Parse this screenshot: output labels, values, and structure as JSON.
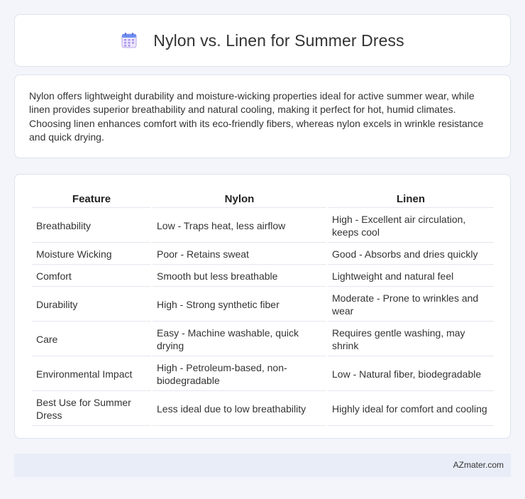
{
  "header": {
    "title": "Nylon vs. Linen for Summer Dress",
    "icon": "calendar-icon"
  },
  "summary": "Nylon offers lightweight durability and moisture-wicking properties ideal for active summer wear, while linen provides superior breathability and natural cooling, making it perfect for hot, humid climates. Choosing linen enhances comfort with its eco-friendly fibers, whereas nylon excels in wrinkle resistance and quick drying.",
  "table": {
    "headers": [
      "Feature",
      "Nylon",
      "Linen"
    ],
    "rows": [
      [
        "Breathability",
        "Low - Traps heat, less airflow",
        "High - Excellent air circulation, keeps cool"
      ],
      [
        "Moisture Wicking",
        "Poor - Retains sweat",
        "Good - Absorbs and dries quickly"
      ],
      [
        "Comfort",
        "Smooth but less breathable",
        "Lightweight and natural feel"
      ],
      [
        "Durability",
        "High - Strong synthetic fiber",
        "Moderate - Prone to wrinkles and wear"
      ],
      [
        "Care",
        "Easy - Machine washable, quick drying",
        "Requires gentle washing, may shrink"
      ],
      [
        "Environmental Impact",
        "High - Petroleum-based, non-biodegradable",
        "Low - Natural fiber, biodegradable"
      ],
      [
        "Best Use for Summer Dress",
        "Less ideal due to low breathability",
        "Highly ideal for comfort and cooling"
      ]
    ]
  },
  "footer": {
    "site": "AZmater.com"
  }
}
